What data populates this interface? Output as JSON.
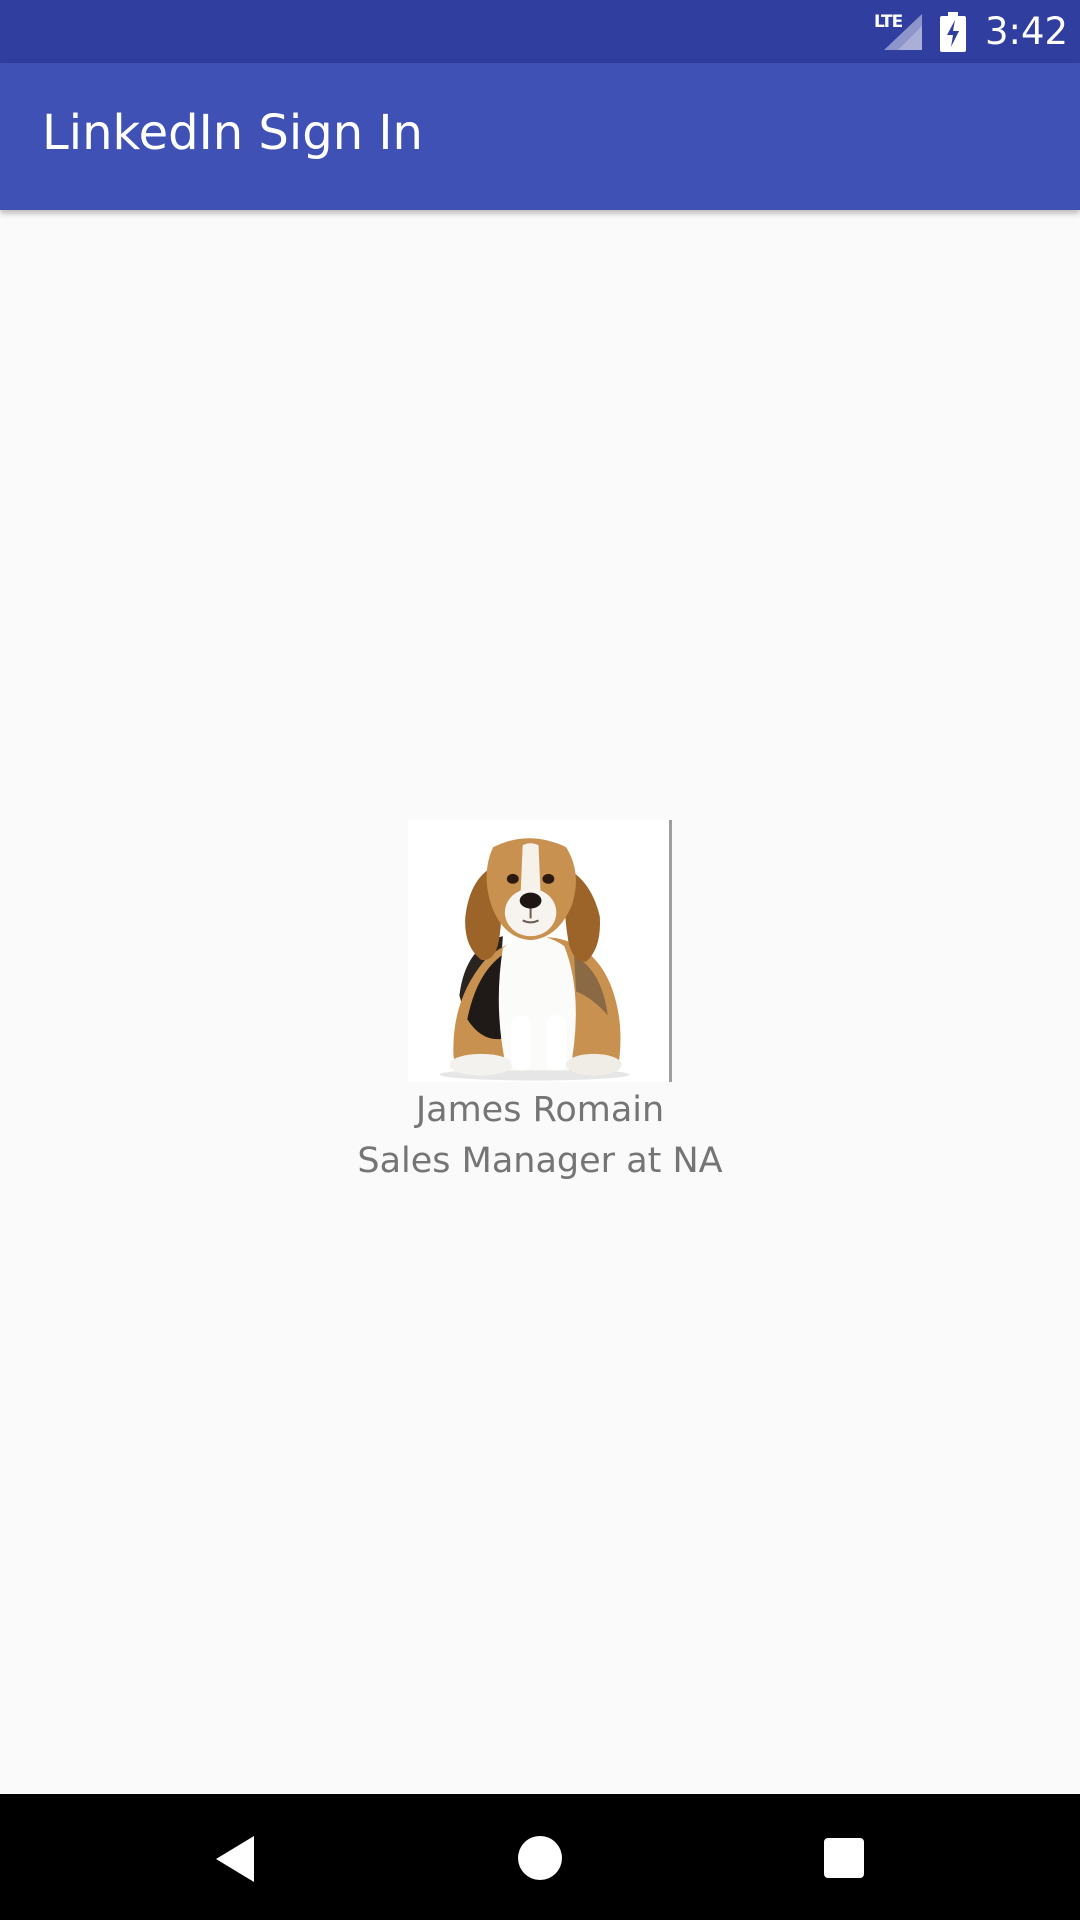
{
  "status_bar": {
    "network": "LTE",
    "time": "3:42",
    "icons": [
      "signal-icon",
      "battery-charging-icon"
    ],
    "color": "#303f9f"
  },
  "app_bar": {
    "title": "LinkedIn Sign In",
    "color": "#3f51b5"
  },
  "profile": {
    "name": "James Romain",
    "headline": "Sales Manager at NA",
    "photo_icon": "beagle-dog-photo"
  },
  "nav_bar": {
    "buttons": [
      "back-icon",
      "home-icon",
      "recents-icon"
    ]
  }
}
